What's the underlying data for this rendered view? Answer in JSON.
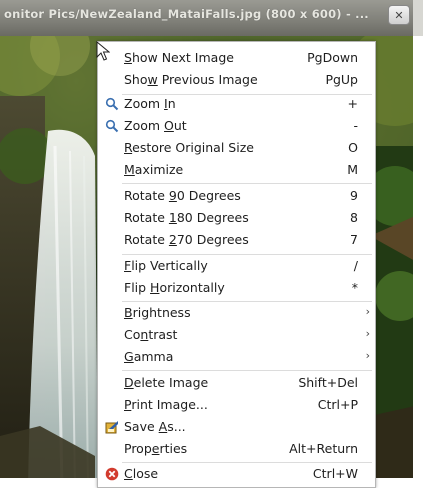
{
  "window": {
    "title": "onitor Pics/NewZealand_MataiFalls.jpg (800 x 600) - ...",
    "title_button_glyph": "✕"
  },
  "menu": {
    "items": [
      {
        "label": "Show Next Image",
        "mnemonic": "S",
        "shortcut": "PgDown"
      },
      {
        "label": "Show Previous Image",
        "mnemonic": "w",
        "shortcut": "PgUp"
      },
      {
        "label": "Zoom In",
        "mnemonic": "I",
        "shortcut": "+",
        "icon": "zoom-in-icon"
      },
      {
        "label": "Zoom Out",
        "mnemonic": "O",
        "shortcut": "-",
        "icon": "zoom-out-icon"
      },
      {
        "label": "Restore Original Size",
        "mnemonic": "R",
        "shortcut": "O"
      },
      {
        "label": "Maximize",
        "mnemonic": "M",
        "shortcut": "M"
      },
      {
        "label": "Rotate 90 Degrees",
        "mnemonic": "9",
        "shortcut": "9"
      },
      {
        "label": "Rotate 180 Degrees",
        "mnemonic": "1",
        "shortcut": "8"
      },
      {
        "label": "Rotate 270 Degrees",
        "mnemonic": "2",
        "shortcut": "7"
      },
      {
        "label": "Flip Vertically",
        "mnemonic": "F",
        "shortcut": "/"
      },
      {
        "label": "Flip Horizontally",
        "mnemonic": "H",
        "shortcut": "*"
      },
      {
        "label": "Brightness",
        "mnemonic": "B",
        "submenu": true
      },
      {
        "label": "Contrast",
        "mnemonic": "n",
        "submenu": true
      },
      {
        "label": "Gamma",
        "mnemonic": "G",
        "submenu": true
      },
      {
        "label": "Delete Image",
        "mnemonic": "D",
        "shortcut": "Shift+Del"
      },
      {
        "label": "Print Image...",
        "mnemonic": "P",
        "shortcut": "Ctrl+P"
      },
      {
        "label": "Save As...",
        "mnemonic": "A",
        "icon": "save-icon"
      },
      {
        "label": "Properties",
        "mnemonic": "e",
        "shortcut": "Alt+Return"
      },
      {
        "label": "Close",
        "mnemonic": "C",
        "shortcut": "Ctrl+W",
        "icon": "close-icon"
      }
    ],
    "submenu_arrow": "›"
  },
  "colors": {
    "menu_bg": "#ffffff",
    "text": "#1e1e1e",
    "separator": "#dcdcdc",
    "zoom_icon": "#3a6fb0",
    "close_icon": "#d23b2e",
    "title_text": "#e6e6df"
  }
}
